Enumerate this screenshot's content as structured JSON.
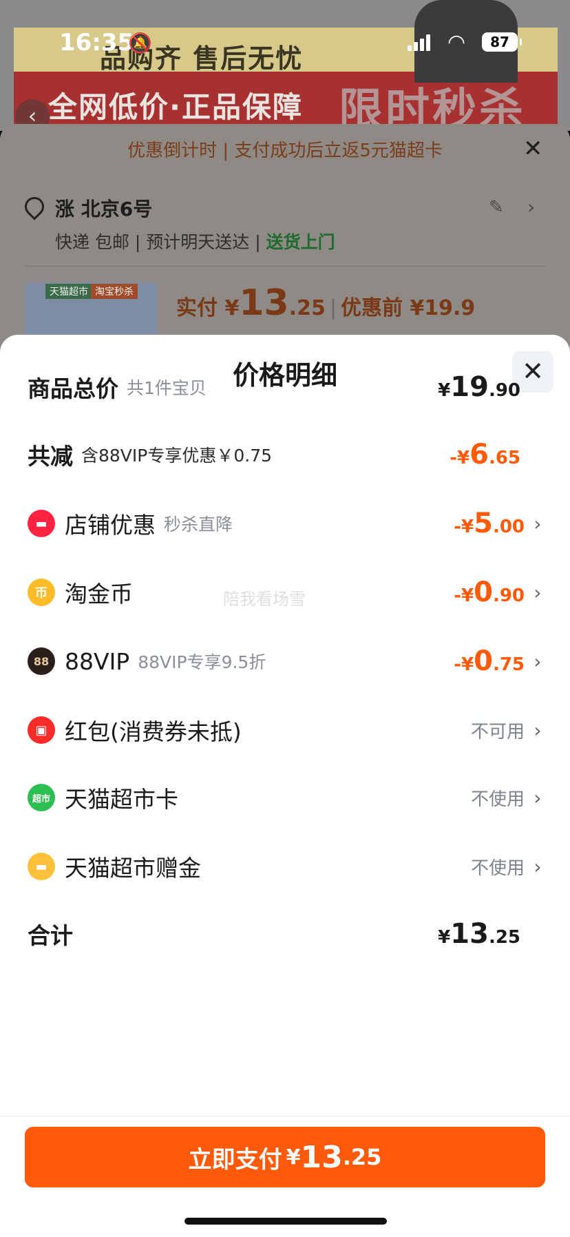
{
  "status_bar": {
    "time": "16:35",
    "battery": "87"
  },
  "background": {
    "banner_top_text": "品购齐 售后无忧",
    "banner_main_text": "全网低价·正品保障",
    "banner_big_text": "限时秒杀",
    "promo_text": "优惠倒计时 | 支付成功后立返5元猫超卡",
    "address": {
      "name": "涨 北京6号",
      "shipping": "快递 包邮",
      "eta": "预计明天送达",
      "delivery": "送货上门"
    },
    "product": {
      "tag1": "天猫超市",
      "tag2": "淘宝秒杀",
      "paid_label": "实付 ¥",
      "paid_int": "13",
      "paid_dec": ".25",
      "before_label": "优惠前 ¥19.9"
    }
  },
  "modal": {
    "title": "价格明细",
    "watermark": "陪我看场雪",
    "rows": {
      "subtotal": {
        "label": "商品总价",
        "sub": "共1件宝贝",
        "cur": "¥",
        "int": "19",
        "dec": ".90"
      },
      "discount_total": {
        "label": "共减",
        "sub": "含88VIP专享优惠￥0.75",
        "cur": "-¥",
        "int": "6",
        "dec": ".65"
      },
      "shop_discount": {
        "label": "店铺优惠",
        "sub": "秒杀直降",
        "cur": "-¥",
        "int": "5",
        "dec": ".00"
      },
      "taojinbi": {
        "label": "淘金币",
        "icon_text": "币",
        "cur": "-¥",
        "int": "0",
        "dec": ".90"
      },
      "vip88": {
        "label": "88VIP",
        "icon_text": "88",
        "sub": "88VIP专享9.5折",
        "cur": "-¥",
        "int": "0",
        "dec": ".75"
      },
      "red_packet": {
        "label": "红包(消费券未抵)",
        "status": "不可用"
      },
      "tmall_card": {
        "label": "天猫超市卡",
        "icon_text": "超市",
        "status": "不使用"
      },
      "tmall_gift": {
        "label": "天猫超市赠金",
        "status": "不使用"
      },
      "total": {
        "label": "合计",
        "cur": "¥",
        "int": "13",
        "dec": ".25"
      }
    },
    "pay_button": {
      "label": "立即支付",
      "cur": "¥",
      "int": "13",
      "dec": ".25"
    }
  },
  "colors": {
    "accent": "#ff5a0a",
    "sheet_bg": "#ffffff"
  }
}
